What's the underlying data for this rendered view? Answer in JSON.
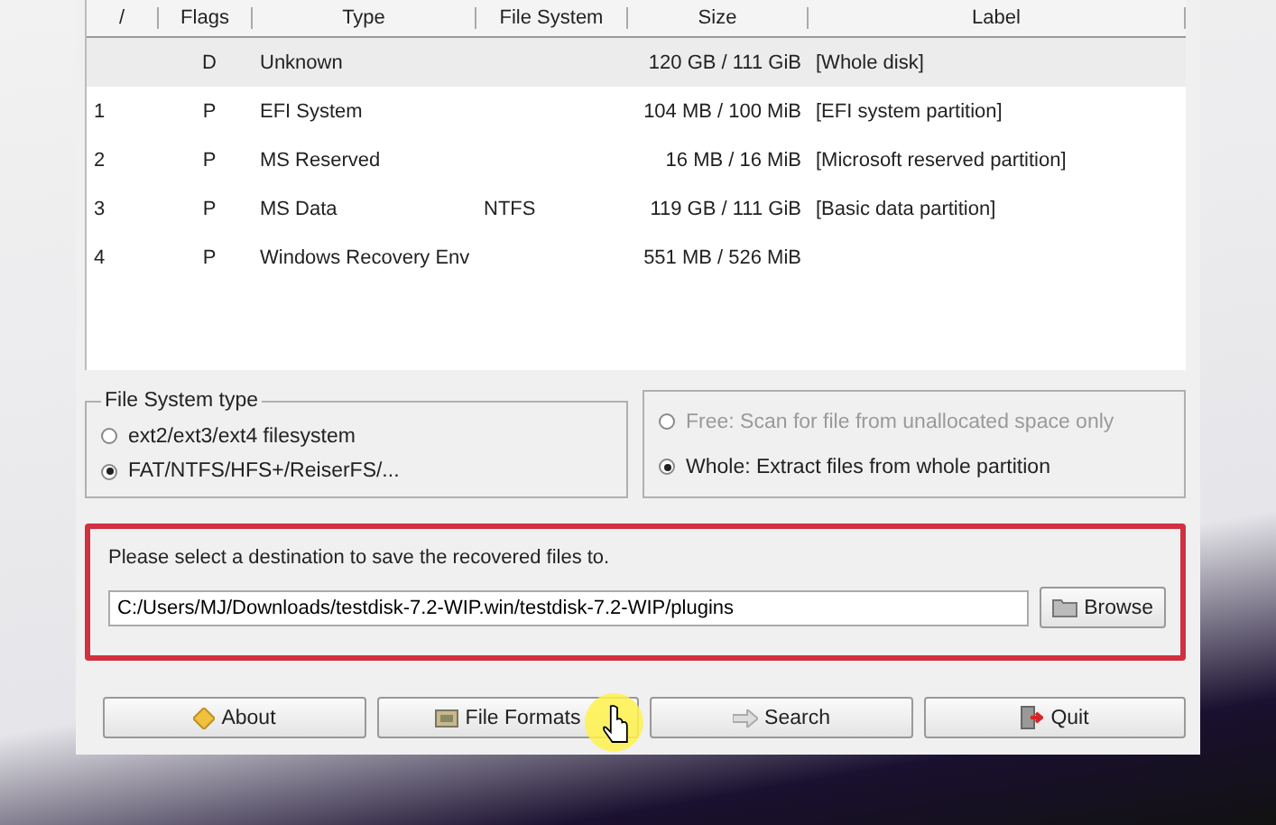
{
  "table": {
    "columns": [
      "/",
      "Flags",
      "Type",
      "File System",
      "Size",
      "Label"
    ],
    "rows": [
      {
        "cells": [
          "",
          "D",
          "Unknown",
          "",
          "120 GB / 111 GiB",
          "[Whole disk]"
        ],
        "selected": true
      },
      {
        "cells": [
          "1",
          "P",
          "EFI System",
          "",
          "104 MB / 100 MiB",
          "[EFI system partition]"
        ],
        "selected": false
      },
      {
        "cells": [
          "2",
          "P",
          "MS Reserved",
          "",
          "16 MB / 16 MiB",
          "[Microsoft reserved partition]"
        ],
        "selected": false
      },
      {
        "cells": [
          "3",
          "P",
          "MS Data",
          "NTFS",
          "119 GB / 111 GiB",
          "[Basic data partition]"
        ],
        "selected": false
      },
      {
        "cells": [
          "4",
          "P",
          "Windows Recovery Env",
          "",
          "551 MB / 526 MiB",
          ""
        ],
        "selected": false
      }
    ]
  },
  "filesystem_type": {
    "title": "File System type",
    "options": [
      {
        "label": "ext2/ext3/ext4 filesystem",
        "selected": false
      },
      {
        "label": "FAT/NTFS/HFS+/ReiserFS/...",
        "selected": true
      }
    ]
  },
  "scan_mode": {
    "options": [
      {
        "label": "Free: Scan for file from unallocated space only",
        "selected": false,
        "disabled": true
      },
      {
        "label": "Whole: Extract files from whole partition",
        "selected": true,
        "disabled": false
      }
    ]
  },
  "destination": {
    "prompt": "Please select a destination to save the recovered files to.",
    "path": "C:/Users/MJ/Downloads/testdisk-7.2-WIP.win/testdisk-7.2-WIP/plugins",
    "browse": "Browse"
  },
  "buttons": [
    {
      "label": "About",
      "kind": "about"
    },
    {
      "label": "File Formats",
      "kind": "formats"
    },
    {
      "label": "Search",
      "kind": "search"
    },
    {
      "label": "Quit",
      "kind": "quit"
    }
  ]
}
